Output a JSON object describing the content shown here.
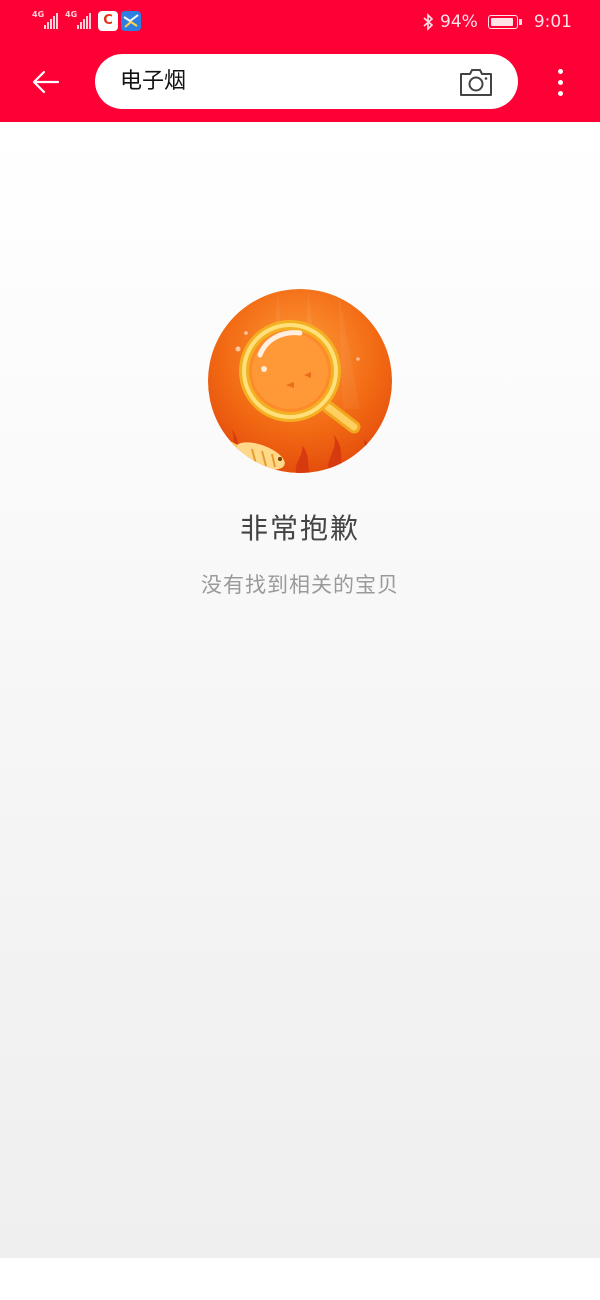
{
  "status_bar": {
    "sim1": "4G",
    "sim2": "4G",
    "app_icon_1": "C",
    "battery_percent": "94%",
    "battery_level": 0.94,
    "time": "9:01"
  },
  "nav": {
    "back_icon": "arrow-left-icon",
    "search_value": "电子烟",
    "camera_icon": "camera-icon",
    "more_icon": "more-vertical-icon"
  },
  "empty_state": {
    "title": "非常抱歉",
    "subtitle": "没有找到相关的宝贝"
  },
  "colors": {
    "header": "#ff0036",
    "illustration": "#f26a13"
  }
}
